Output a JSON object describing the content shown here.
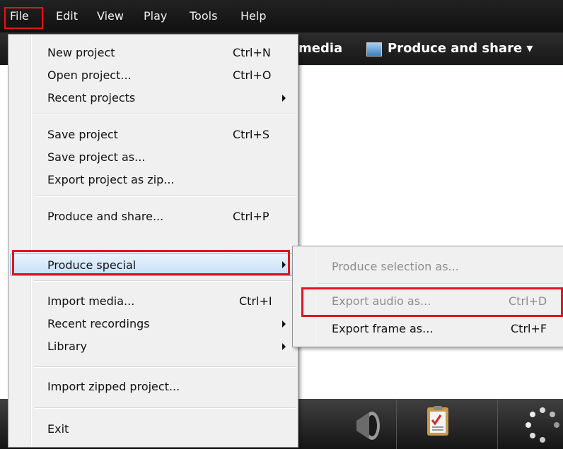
{
  "menubar": {
    "items": [
      "File",
      "Edit",
      "View",
      "Play",
      "Tools",
      "Help"
    ]
  },
  "toolbar": {
    "media_label": "media",
    "produce_label": "Produce and share ▾"
  },
  "file_menu": {
    "items": [
      {
        "label": "New project",
        "shortcut": "Ctrl+N"
      },
      {
        "label": "Open project...",
        "shortcut": "Ctrl+O"
      },
      {
        "label": "Recent projects",
        "shortcut": ""
      },
      {
        "label": "Save project",
        "shortcut": "Ctrl+S"
      },
      {
        "label": "Save project as...",
        "shortcut": ""
      },
      {
        "label": "Export project as zip...",
        "shortcut": ""
      },
      {
        "label": "Produce and share...",
        "shortcut": "Ctrl+P"
      },
      {
        "label": "Produce special",
        "shortcut": ""
      },
      {
        "label": "Import media...",
        "shortcut": "Ctrl+I"
      },
      {
        "label": "Recent recordings",
        "shortcut": ""
      },
      {
        "label": "Library",
        "shortcut": ""
      },
      {
        "label": "Import zipped project...",
        "shortcut": ""
      },
      {
        "label": "Exit",
        "shortcut": ""
      }
    ]
  },
  "submenu": {
    "items": [
      {
        "label": "Produce selection as...",
        "shortcut": ""
      },
      {
        "label": "Export audio as...",
        "shortcut": "Ctrl+D"
      },
      {
        "label": "Export frame as...",
        "shortcut": "Ctrl+F"
      }
    ]
  },
  "colors": {
    "highlight_red": "#e3141c",
    "menubar": "#1a1a1a",
    "menu_bg": "#f0f0f0"
  }
}
